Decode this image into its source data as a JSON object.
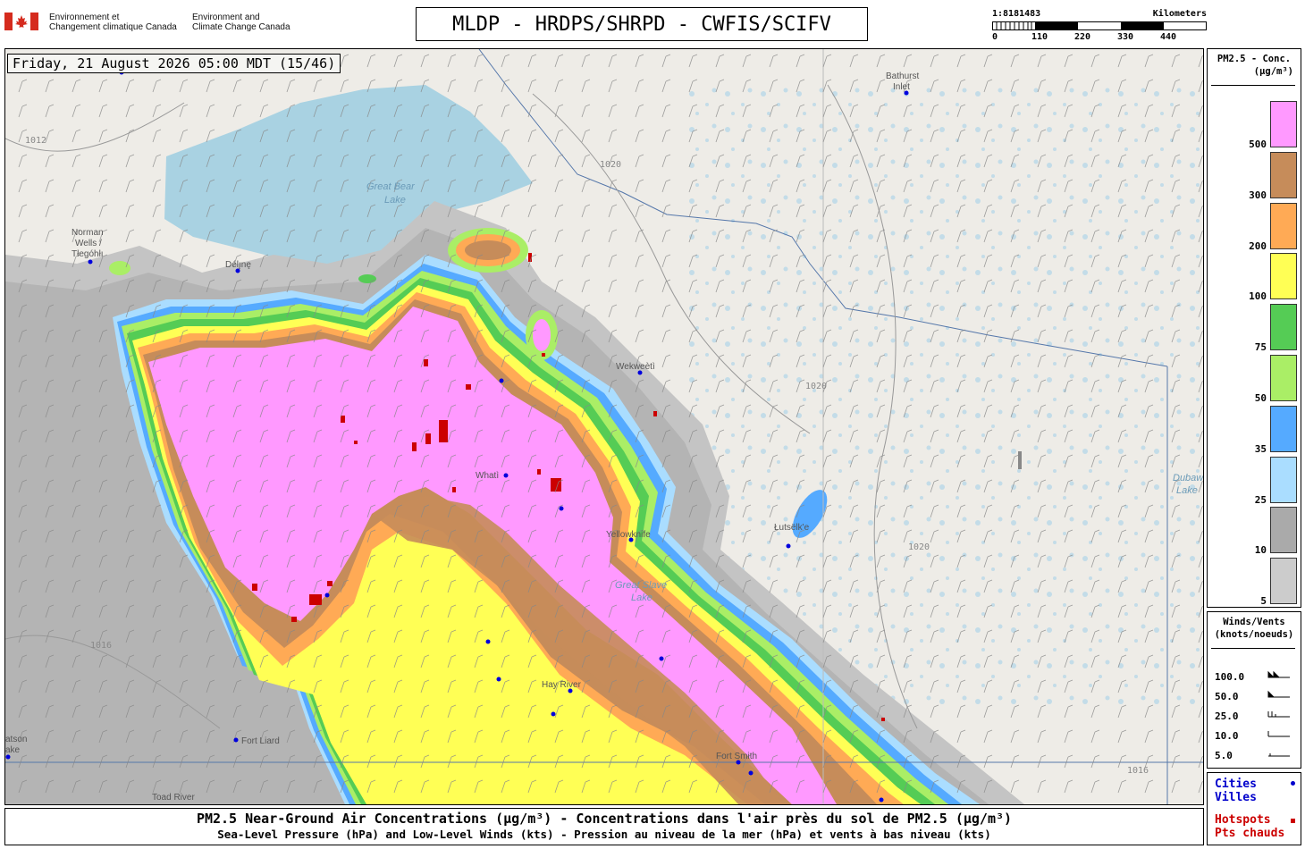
{
  "header": {
    "dept_fr_line1": "Environnement et",
    "dept_fr_line2": "Changement climatique Canada",
    "dept_en_line1": "Environment and",
    "dept_en_line2": "Climate Change Canada",
    "title": "MLDP - HRDPS/SHRPD - CWFIS/SCIFV"
  },
  "scale": {
    "ratio": "1:8181483",
    "unit": "Kilometers",
    "ticks": [
      "0",
      "110",
      "220",
      "330",
      "440"
    ]
  },
  "map": {
    "timestamp": "Friday, 21 August 2026 05:00 MDT (15/46)",
    "cities": [
      {
        "name": "Norman Wells / Tłegóhłı",
        "line1": "Norman",
        "line2": "Wells /",
        "line3": "Tłegóhłı"
      },
      {
        "name": "Délı̨nę",
        "line1": "Délı̨nę"
      },
      {
        "name": "Bathurst Inlet",
        "line1": "Bathurst",
        "line2": "Inlet"
      },
      {
        "name": "Wekweètì",
        "line1": "Wekweètì"
      },
      {
        "name": "Whatì",
        "line1": "Whatì"
      },
      {
        "name": "Yellowknife",
        "line1": "Yellowknife"
      },
      {
        "name": "Łutsëlk'e",
        "line1": "Łutsëlk'e"
      },
      {
        "name": "Hay River",
        "line1": "Hay River"
      },
      {
        "name": "Fort Liard",
        "line1": "Fort Liard"
      },
      {
        "name": "Fort Smith",
        "line1": "Fort Smith"
      },
      {
        "name": "Toad River",
        "line1": "Toad River"
      },
      {
        "name": "Watson Lake",
        "line1": "atson",
        "line2": "ake"
      }
    ],
    "lakes": [
      {
        "name": "Great Bear Lake",
        "line1": "Great Bear",
        "line2": "Lake"
      },
      {
        "name": "Great Slave Lake",
        "line1": "Great Slave",
        "line2": "Lake"
      },
      {
        "name": "Dubawnt Lake",
        "line1": "Dubawnt",
        "line2": "Lake"
      }
    ],
    "isobars": [
      "1012",
      "1016",
      "1020"
    ]
  },
  "legend_concentration": {
    "title_line1": "PM2.5 - Conc.",
    "title_line2": "(µg/m³)",
    "levels": [
      {
        "label": "500",
        "color": "#ff99ff"
      },
      {
        "label": "300",
        "color": "#c68c5a"
      },
      {
        "label": "200",
        "color": "#ffaa55"
      },
      {
        "label": "100",
        "color": "#ffff55"
      },
      {
        "label": "75",
        "color": "#55cc55"
      },
      {
        "label": "50",
        "color": "#aaee66"
      },
      {
        "label": "35",
        "color": "#55aaff"
      },
      {
        "label": "25",
        "color": "#aaddff"
      },
      {
        "label": "10",
        "color": "#aaaaaa"
      },
      {
        "label": "5",
        "color": "#cccccc"
      }
    ]
  },
  "legend_winds": {
    "title_line1": "Winds/Vents",
    "title_line2": "(knots/noeuds)",
    "speeds": [
      "100.0",
      "50.0",
      "25.0",
      "10.0",
      "5.0"
    ]
  },
  "legend_points": {
    "cities_en": "Cities",
    "cities_fr": "Villes",
    "hotspots_en": "Hotspots",
    "hotspots_fr": "Pts chauds",
    "city_color": "#0000cc",
    "hotspot_color": "#cc0000"
  },
  "caption": {
    "line1": "PM2.5 Near-Ground Air Concentrations (µg/m³) - Concentrations dans l'air près du sol de PM2.5 (µg/m³)",
    "line2": "Sea-Level Pressure (hPa) and Low-Level Winds (kts) - Pression au niveau de la mer (hPa) et vents à bas niveau (kts)"
  }
}
